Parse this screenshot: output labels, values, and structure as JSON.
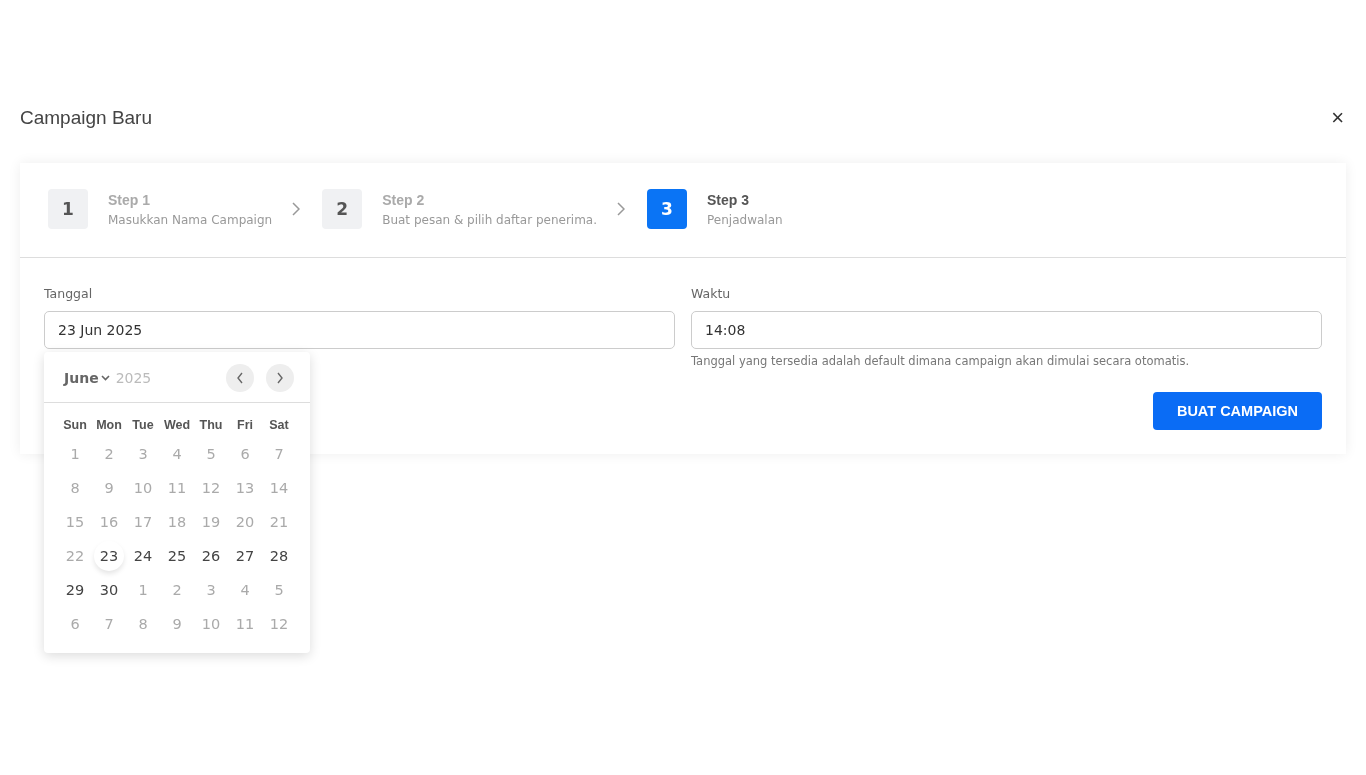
{
  "dialog": {
    "title": "Campaign Baru",
    "close": "×"
  },
  "steps": [
    {
      "number": "1",
      "title": "Step 1",
      "subtitle": "Masukkan Nama Campaign",
      "selected": false
    },
    {
      "number": "2",
      "title": "Step 2",
      "subtitle": "Buat pesan & pilih daftar penerima.",
      "selected": false
    },
    {
      "number": "3",
      "title": "Step 3",
      "subtitle": "Penjadwalan",
      "selected": true
    }
  ],
  "date_field": {
    "label": "Tanggal",
    "value": "23 Jun 2025"
  },
  "time_field": {
    "label": "Waktu",
    "value": "14:08",
    "hint": "Tanggal yang tersedia adalah default dimana campaign akan dimulai secara otomatis."
  },
  "submit_button": "BUAT CAMPAIGN",
  "calendar": {
    "month": "June",
    "year": "2025",
    "weekdays": [
      "Sun",
      "Mon",
      "Tue",
      "Wed",
      "Thu",
      "Fri",
      "Sat"
    ],
    "days": [
      {
        "label": "1",
        "disabled": true,
        "selected": false
      },
      {
        "label": "2",
        "disabled": true,
        "selected": false
      },
      {
        "label": "3",
        "disabled": true,
        "selected": false
      },
      {
        "label": "4",
        "disabled": true,
        "selected": false
      },
      {
        "label": "5",
        "disabled": true,
        "selected": false
      },
      {
        "label": "6",
        "disabled": true,
        "selected": false
      },
      {
        "label": "7",
        "disabled": true,
        "selected": false
      },
      {
        "label": "8",
        "disabled": true,
        "selected": false
      },
      {
        "label": "9",
        "disabled": true,
        "selected": false
      },
      {
        "label": "10",
        "disabled": true,
        "selected": false
      },
      {
        "label": "11",
        "disabled": true,
        "selected": false
      },
      {
        "label": "12",
        "disabled": true,
        "selected": false
      },
      {
        "label": "13",
        "disabled": true,
        "selected": false
      },
      {
        "label": "14",
        "disabled": true,
        "selected": false
      },
      {
        "label": "15",
        "disabled": true,
        "selected": false
      },
      {
        "label": "16",
        "disabled": true,
        "selected": false
      },
      {
        "label": "17",
        "disabled": true,
        "selected": false
      },
      {
        "label": "18",
        "disabled": true,
        "selected": false
      },
      {
        "label": "19",
        "disabled": true,
        "selected": false
      },
      {
        "label": "20",
        "disabled": true,
        "selected": false
      },
      {
        "label": "21",
        "disabled": true,
        "selected": false
      },
      {
        "label": "22",
        "disabled": true,
        "selected": false
      },
      {
        "label": "23",
        "disabled": false,
        "selected": true
      },
      {
        "label": "24",
        "disabled": false,
        "selected": false
      },
      {
        "label": "25",
        "disabled": false,
        "selected": false
      },
      {
        "label": "26",
        "disabled": false,
        "selected": false
      },
      {
        "label": "27",
        "disabled": false,
        "selected": false
      },
      {
        "label": "28",
        "disabled": false,
        "selected": false
      },
      {
        "label": "29",
        "disabled": false,
        "selected": false
      },
      {
        "label": "30",
        "disabled": false,
        "selected": false
      },
      {
        "label": "1",
        "disabled": true,
        "selected": false
      },
      {
        "label": "2",
        "disabled": true,
        "selected": false
      },
      {
        "label": "3",
        "disabled": true,
        "selected": false
      },
      {
        "label": "4",
        "disabled": true,
        "selected": false
      },
      {
        "label": "5",
        "disabled": true,
        "selected": false
      },
      {
        "label": "6",
        "disabled": true,
        "selected": false
      },
      {
        "label": "7",
        "disabled": true,
        "selected": false
      },
      {
        "label": "8",
        "disabled": true,
        "selected": false
      },
      {
        "label": "9",
        "disabled": true,
        "selected": false
      },
      {
        "label": "10",
        "disabled": true,
        "selected": false
      },
      {
        "label": "11",
        "disabled": true,
        "selected": false
      },
      {
        "label": "12",
        "disabled": true,
        "selected": false
      }
    ]
  }
}
